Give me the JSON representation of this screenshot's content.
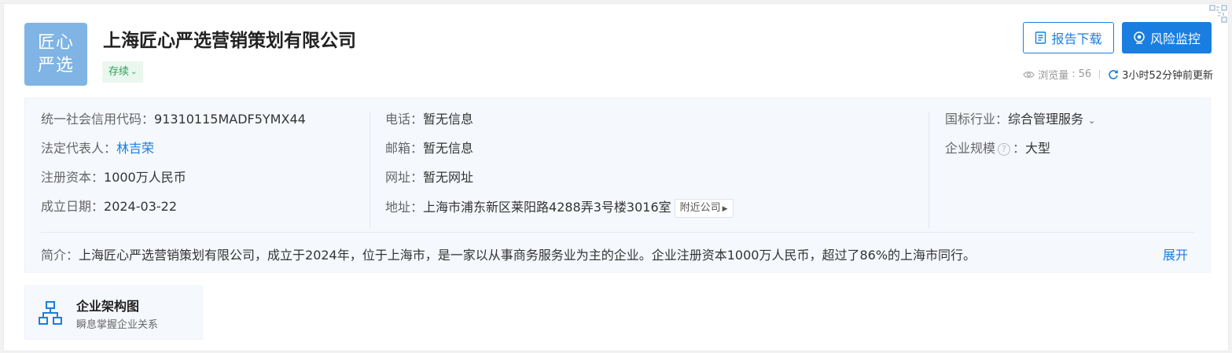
{
  "company": {
    "logo_line1": "匠心",
    "logo_line2": "严选",
    "name": "上海匠心严选营销策划有限公司",
    "status": "存续",
    "brand_color": "#1a7ee0",
    "logo_color": "#7fb4e4",
    "status_color": "#2c9f5a"
  },
  "actions": {
    "report_label": "报告下载",
    "risk_label": "风险监控"
  },
  "meta": {
    "views_label": "浏览量",
    "views_count": "56",
    "update_text": "3小时52分钟前更新"
  },
  "info": {
    "credit_code_label": "统一社会信用代码：",
    "credit_code": "91310115MADF5YMX44",
    "legal_rep_label": "法定代表人：",
    "legal_rep": "林吉荣",
    "capital_label": "注册资本：",
    "capital": "1000万人民币",
    "founded_label": "成立日期：",
    "founded": "2024-03-22",
    "phone_label": "电话：",
    "phone": "暂无信息",
    "email_label": "邮箱：",
    "email": "暂无信息",
    "website_label": "网址：",
    "website": "暂无网址",
    "address_label": "地址：",
    "address": "上海市浦东新区莱阳路4288弄3号楼3016室",
    "nearby_label": "附近公司",
    "industry_label": "国标行业：",
    "industry": "综合管理服务",
    "scale_label": "企业规模",
    "scale": "大型"
  },
  "intro": {
    "label": "简介：",
    "text": "上海匠心严选营销策划有限公司，成立于2024年，位于上海市，是一家以从事商务服务业为主的企业。企业注册资本1000万人民币，超过了86%的上海市同行。",
    "expand_label": "展开"
  },
  "structure": {
    "title": "企业架构图",
    "subtitle": "瞬息掌握企业关系"
  },
  "icons": [
    "document-icon",
    "monitor-eye-icon",
    "eye-icon",
    "refresh-icon",
    "chevron-down-icon",
    "question-icon",
    "org-chart-icon",
    "qr-code-icon"
  ]
}
